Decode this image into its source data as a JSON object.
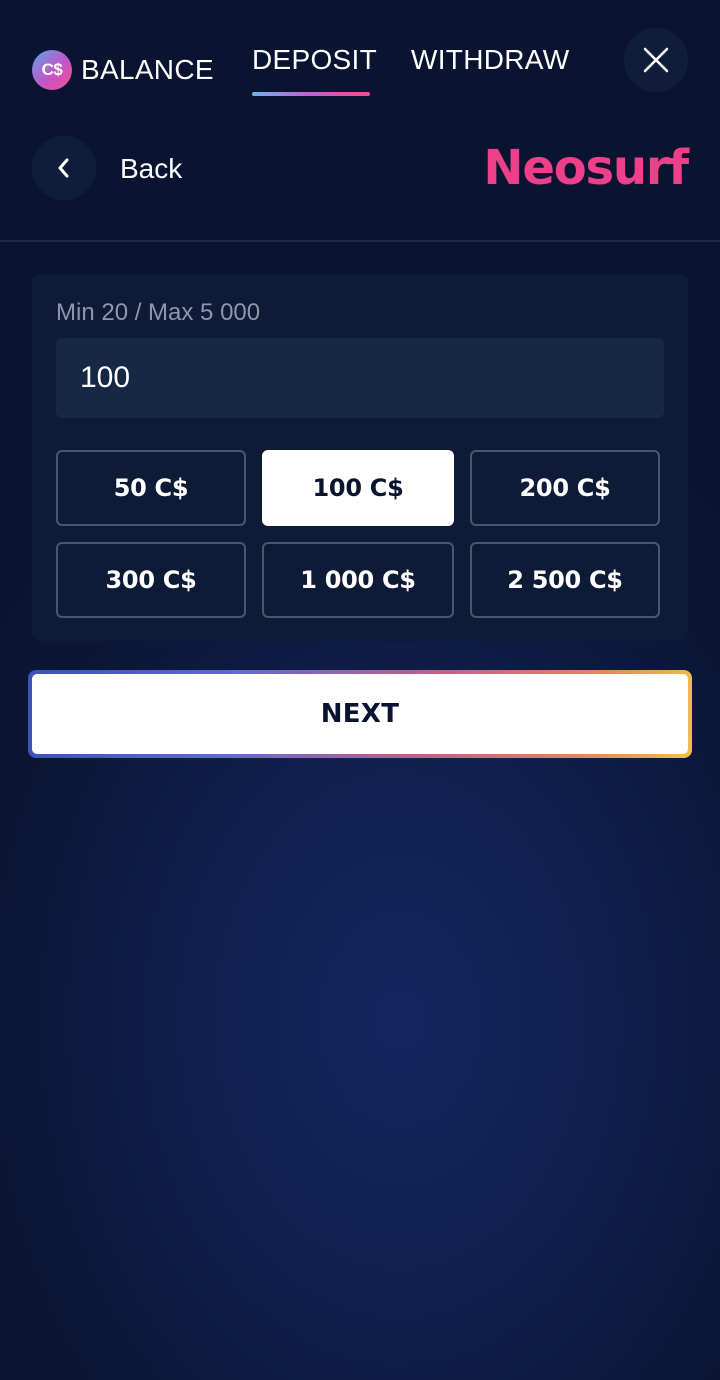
{
  "header": {
    "currency_badge": "C$",
    "tabs": [
      {
        "label": "BALANCE"
      },
      {
        "label": "DEPOSIT",
        "active": true
      },
      {
        "label": "WITHDRAW"
      }
    ]
  },
  "subheader": {
    "back_label": "Back",
    "brand": "Neosurf"
  },
  "form": {
    "limits_hint": "Min 20 / Max 5 000",
    "amount_value": "100",
    "presets": [
      {
        "label": "50 C$"
      },
      {
        "label": "100 C$",
        "selected": true
      },
      {
        "label": "200 C$"
      },
      {
        "label": "300 C$"
      },
      {
        "label": "1 000 C$"
      },
      {
        "label": "2 500 C$"
      }
    ]
  },
  "actions": {
    "next_label": "NEXT"
  },
  "colors": {
    "background": "#0a1430",
    "accent_pink": "#ee3f8b",
    "panel": "#0e1b36",
    "field": "#172845"
  },
  "icons": {
    "close": "close-icon",
    "back": "chevron-left-icon",
    "currency": "currency-coin-icon"
  }
}
